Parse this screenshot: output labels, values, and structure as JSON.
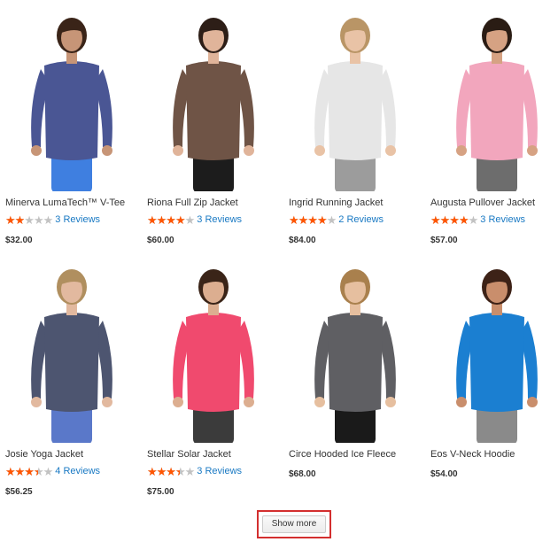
{
  "products": [
    {
      "name": "Minerva LumaTech™ V-Tee",
      "rating": 0.4,
      "reviews": "3 Reviews",
      "price": "$32.00",
      "top_color": "#4a5694",
      "bottom_color": "#3f7fe0",
      "skin": "#c79577",
      "hair": "#3a2418"
    },
    {
      "name": "Riona Full Zip Jacket",
      "rating": 0.8,
      "reviews": "3 Reviews",
      "price": "$60.00",
      "top_color": "#6f5446",
      "bottom_color": "#1c1c1c",
      "skin": "#e0b49a",
      "hair": "#2d1e17"
    },
    {
      "name": "Ingrid Running Jacket",
      "rating": 0.8,
      "reviews": "2 Reviews",
      "price": "$84.00",
      "top_color": "#e6e6e6",
      "bottom_color": "#9c9c9c",
      "skin": "#e9c3a6",
      "hair": "#b99566"
    },
    {
      "name": "Augusta Pullover Jacket",
      "rating": 0.8,
      "reviews": "3 Reviews",
      "price": "$57.00",
      "top_color": "#f2a6bd",
      "bottom_color": "#6d6d6d",
      "skin": "#d6a283",
      "hair": "#2a1c14"
    },
    {
      "name": "Josie Yoga Jacket",
      "rating": 0.7,
      "reviews": "4 Reviews",
      "price": "$56.25",
      "top_color": "#4d5570",
      "bottom_color": "#5a78c9",
      "skin": "#e2b99f",
      "hair": "#b08f5f"
    },
    {
      "name": "Stellar Solar Jacket",
      "rating": 0.7,
      "reviews": "3 Reviews",
      "price": "$75.00",
      "top_color": "#f04a6e",
      "bottom_color": "#3b3b3b",
      "skin": "#dcae90",
      "hair": "#3a2418"
    },
    {
      "name": "Circe Hooded Ice Fleece",
      "rating": null,
      "reviews": "",
      "price": "$68.00",
      "top_color": "#5f5f63",
      "bottom_color": "#1a1a1a",
      "skin": "#e6bf9f",
      "hair": "#a9804d"
    },
    {
      "name": "Eos V-Neck Hoodie",
      "rating": null,
      "reviews": "",
      "price": "$54.00",
      "top_color": "#1b7fd1",
      "bottom_color": "#8a8a8a",
      "skin": "#c98e6c",
      "hair": "#3d2217"
    }
  ],
  "show_more_label": "Show more",
  "accent_star": "#ff5501",
  "highlight_border": "#d32f2f"
}
